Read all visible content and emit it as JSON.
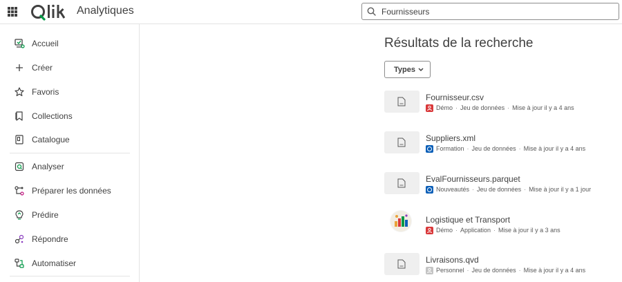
{
  "header": {
    "logo_text": "Qlik",
    "app_name": "Analytiques",
    "search_value": "Fournisseurs",
    "search_icon": "search-icon",
    "launcher_icon": "app-launcher-icon"
  },
  "sidebar": {
    "items": [
      {
        "label": "Accueil",
        "icon": "home-icon"
      },
      {
        "label": "Créer",
        "icon": "plus-icon"
      },
      {
        "label": "Favoris",
        "icon": "star-icon"
      },
      {
        "label": "Collections",
        "icon": "bookmark-icon"
      },
      {
        "label": "Catalogue",
        "icon": "catalog-icon"
      },
      {
        "label": "Analyser",
        "icon": "analyze-icon"
      },
      {
        "label": "Préparer les données",
        "icon": "prepare-data-icon"
      },
      {
        "label": "Prédire",
        "icon": "predict-icon"
      },
      {
        "label": "Répondre",
        "icon": "answer-icon"
      },
      {
        "label": "Automatiser",
        "icon": "automate-icon"
      }
    ]
  },
  "main": {
    "title": "Résultats de la recherche",
    "types_button": "Types",
    "results": [
      {
        "title": "Fournisseur.csv",
        "space": "Démo",
        "type": "Jeu de données",
        "updated": "Mise à jour il y a 4 ans",
        "space_color": "#d9383a",
        "thumb": "file-icon"
      },
      {
        "title": "Suppliers.xml",
        "space": "Formation",
        "type": "Jeu de données",
        "updated": "Mise à jour il y a 4 ans",
        "space_color": "#0b5fb8",
        "thumb": "file-icon"
      },
      {
        "title": "EvalFournisseurs.parquet",
        "space": "Nouveautés",
        "type": "Jeu de données",
        "updated": "Mise à jour il y a 1 jour",
        "space_color": "#0b5fb8",
        "thumb": "file-icon"
      },
      {
        "title": "Logistique et Transport",
        "space": "Démo",
        "type": "Application",
        "updated": "Mise à jour il y a 3 ans",
        "space_color": "#d9383a",
        "thumb": "app-thumbnail"
      },
      {
        "title": "Livraisons.qvd",
        "space": "Personnel",
        "type": "Jeu de données",
        "updated": "Mise à jour il y a 4 ans",
        "space_color": "#c4c4c4",
        "thumb": "file-icon"
      }
    ]
  },
  "colors": {
    "brand_green": "#009845",
    "text": "#404040",
    "border": "#e3e3e3"
  }
}
